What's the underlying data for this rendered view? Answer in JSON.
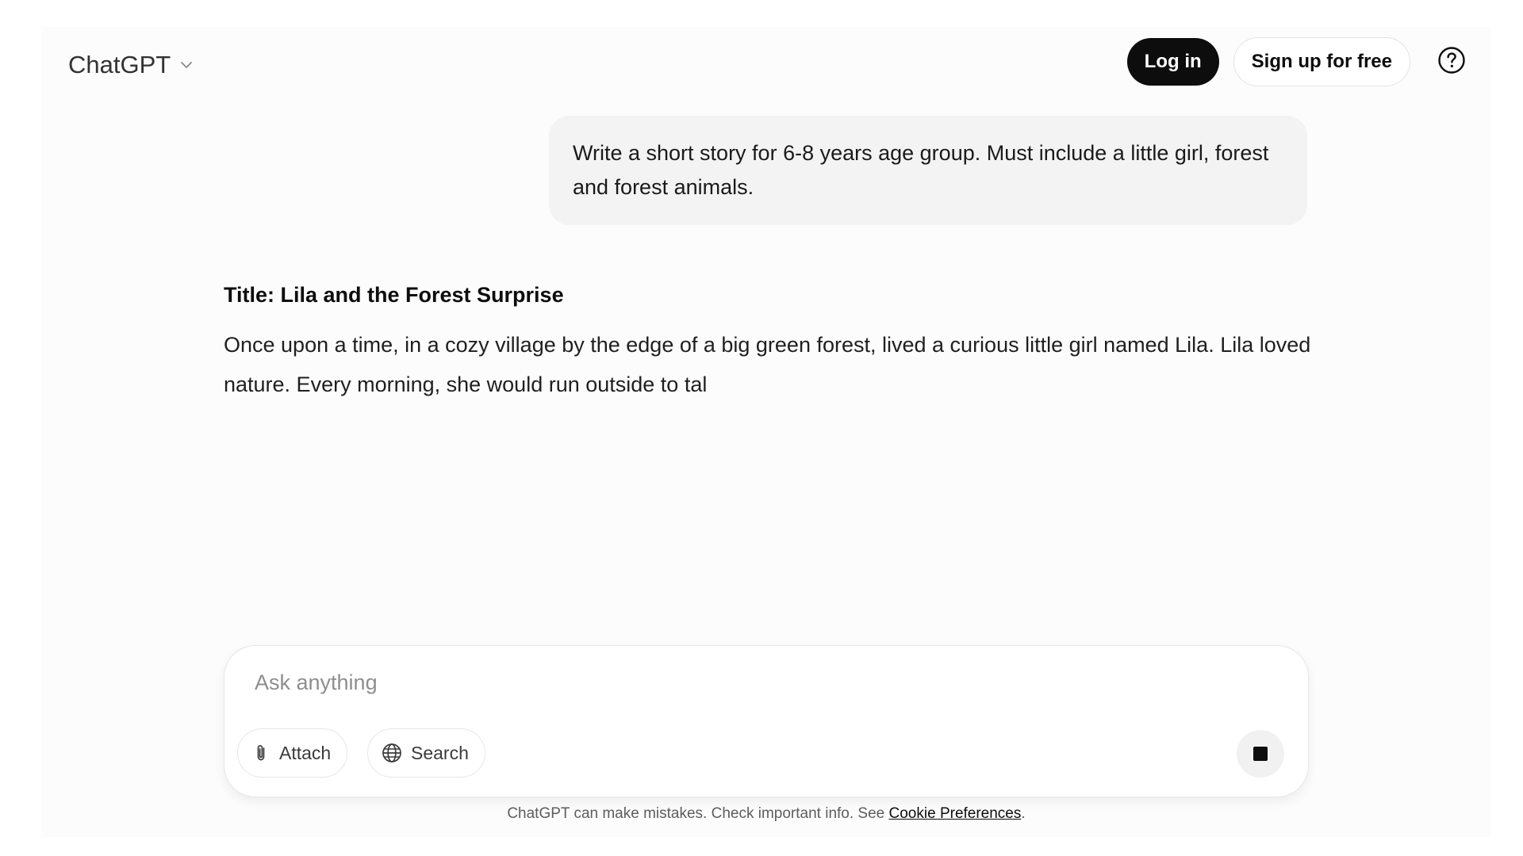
{
  "header": {
    "model_name": "ChatGPT",
    "login_label": "Log in",
    "signup_label": "Sign up for free"
  },
  "conversation": {
    "user_message": "Write a short story for 6-8 years age group. Must include a little girl, forest and forest animals.",
    "assistant": {
      "title": "Title: Lila and the Forest Surprise",
      "paragraph": "Once upon a time, in a cozy village by the edge of a big green forest, lived a curious little girl named Lila. Lila loved nature. Every morning, she would run outside to tal"
    }
  },
  "composer": {
    "placeholder": "Ask anything",
    "attach_label": "Attach",
    "search_label": "Search"
  },
  "footer": {
    "disclaimer": "ChatGPT can make mistakes. Check important info. See",
    "cookie_link": "Cookie Preferences",
    "period": "."
  },
  "colors": {
    "login_bg": "#0d0d0d",
    "bubble_bg": "#f3f3f3",
    "page_bg": "#fcfcfc"
  },
  "icons": {
    "model_chevron": "chevron-down-icon",
    "help": "question-circle-icon",
    "attach": "paperclip-icon",
    "search": "globe-icon",
    "stop": "stop-square-icon"
  }
}
